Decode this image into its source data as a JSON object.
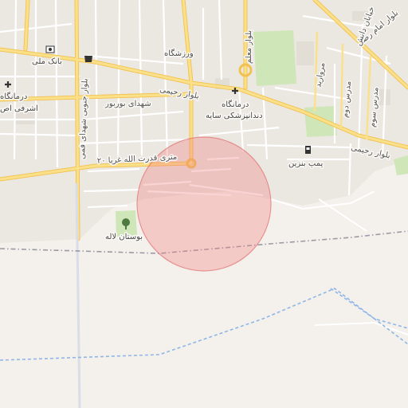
{
  "map": {
    "roads": {
      "rahimi_boulevard": "بلوار رحیمی",
      "shohada_bourbour": "شهدای بوربور",
      "imam_reza": "بلوار امام رضا",
      "moallem": "بلوار معلم",
      "danesh_street": "خیابان دانش",
      "morvarid": "مروارید",
      "gharbi_shahid": "بلوار جنوبی شهدای فمی",
      "street_20m": "۲۰ متری قدرت الله غریا",
      "modares_1": "مدرس دوم",
      "modares_2": "مدرس سوم"
    },
    "pois": {
      "bank_melli": "بانک ملی",
      "clinic_left": "درمانگاه",
      "clinic_left_2": "اشرفی اص",
      "clinic_center": "درمانگاه",
      "dentistry": "دندانپزشکی سایه",
      "stadium": "ورزشگاه",
      "fuel_station": "پمپ بنزین",
      "park": "بوستان لاله"
    },
    "icons": {
      "bank": "bank-icon",
      "shop": "shopping-bag-icon",
      "hospital_left": "hospital-cross-icon",
      "hospital_center": "hospital-cross-icon",
      "fuel": "fuel-pump-icon",
      "park": "tree-icon"
    },
    "highlight": {
      "fill": "#f08080",
      "stroke": "#e06060"
    },
    "colors": {
      "background": "#f4f1ec",
      "urban": "#ebe7e1",
      "major_road": "#fbd56a",
      "minor_road": "#ffffff",
      "green": "#cfe6b8",
      "water_line": "#8fb6e8",
      "boundary": "#9a9aa6"
    }
  }
}
